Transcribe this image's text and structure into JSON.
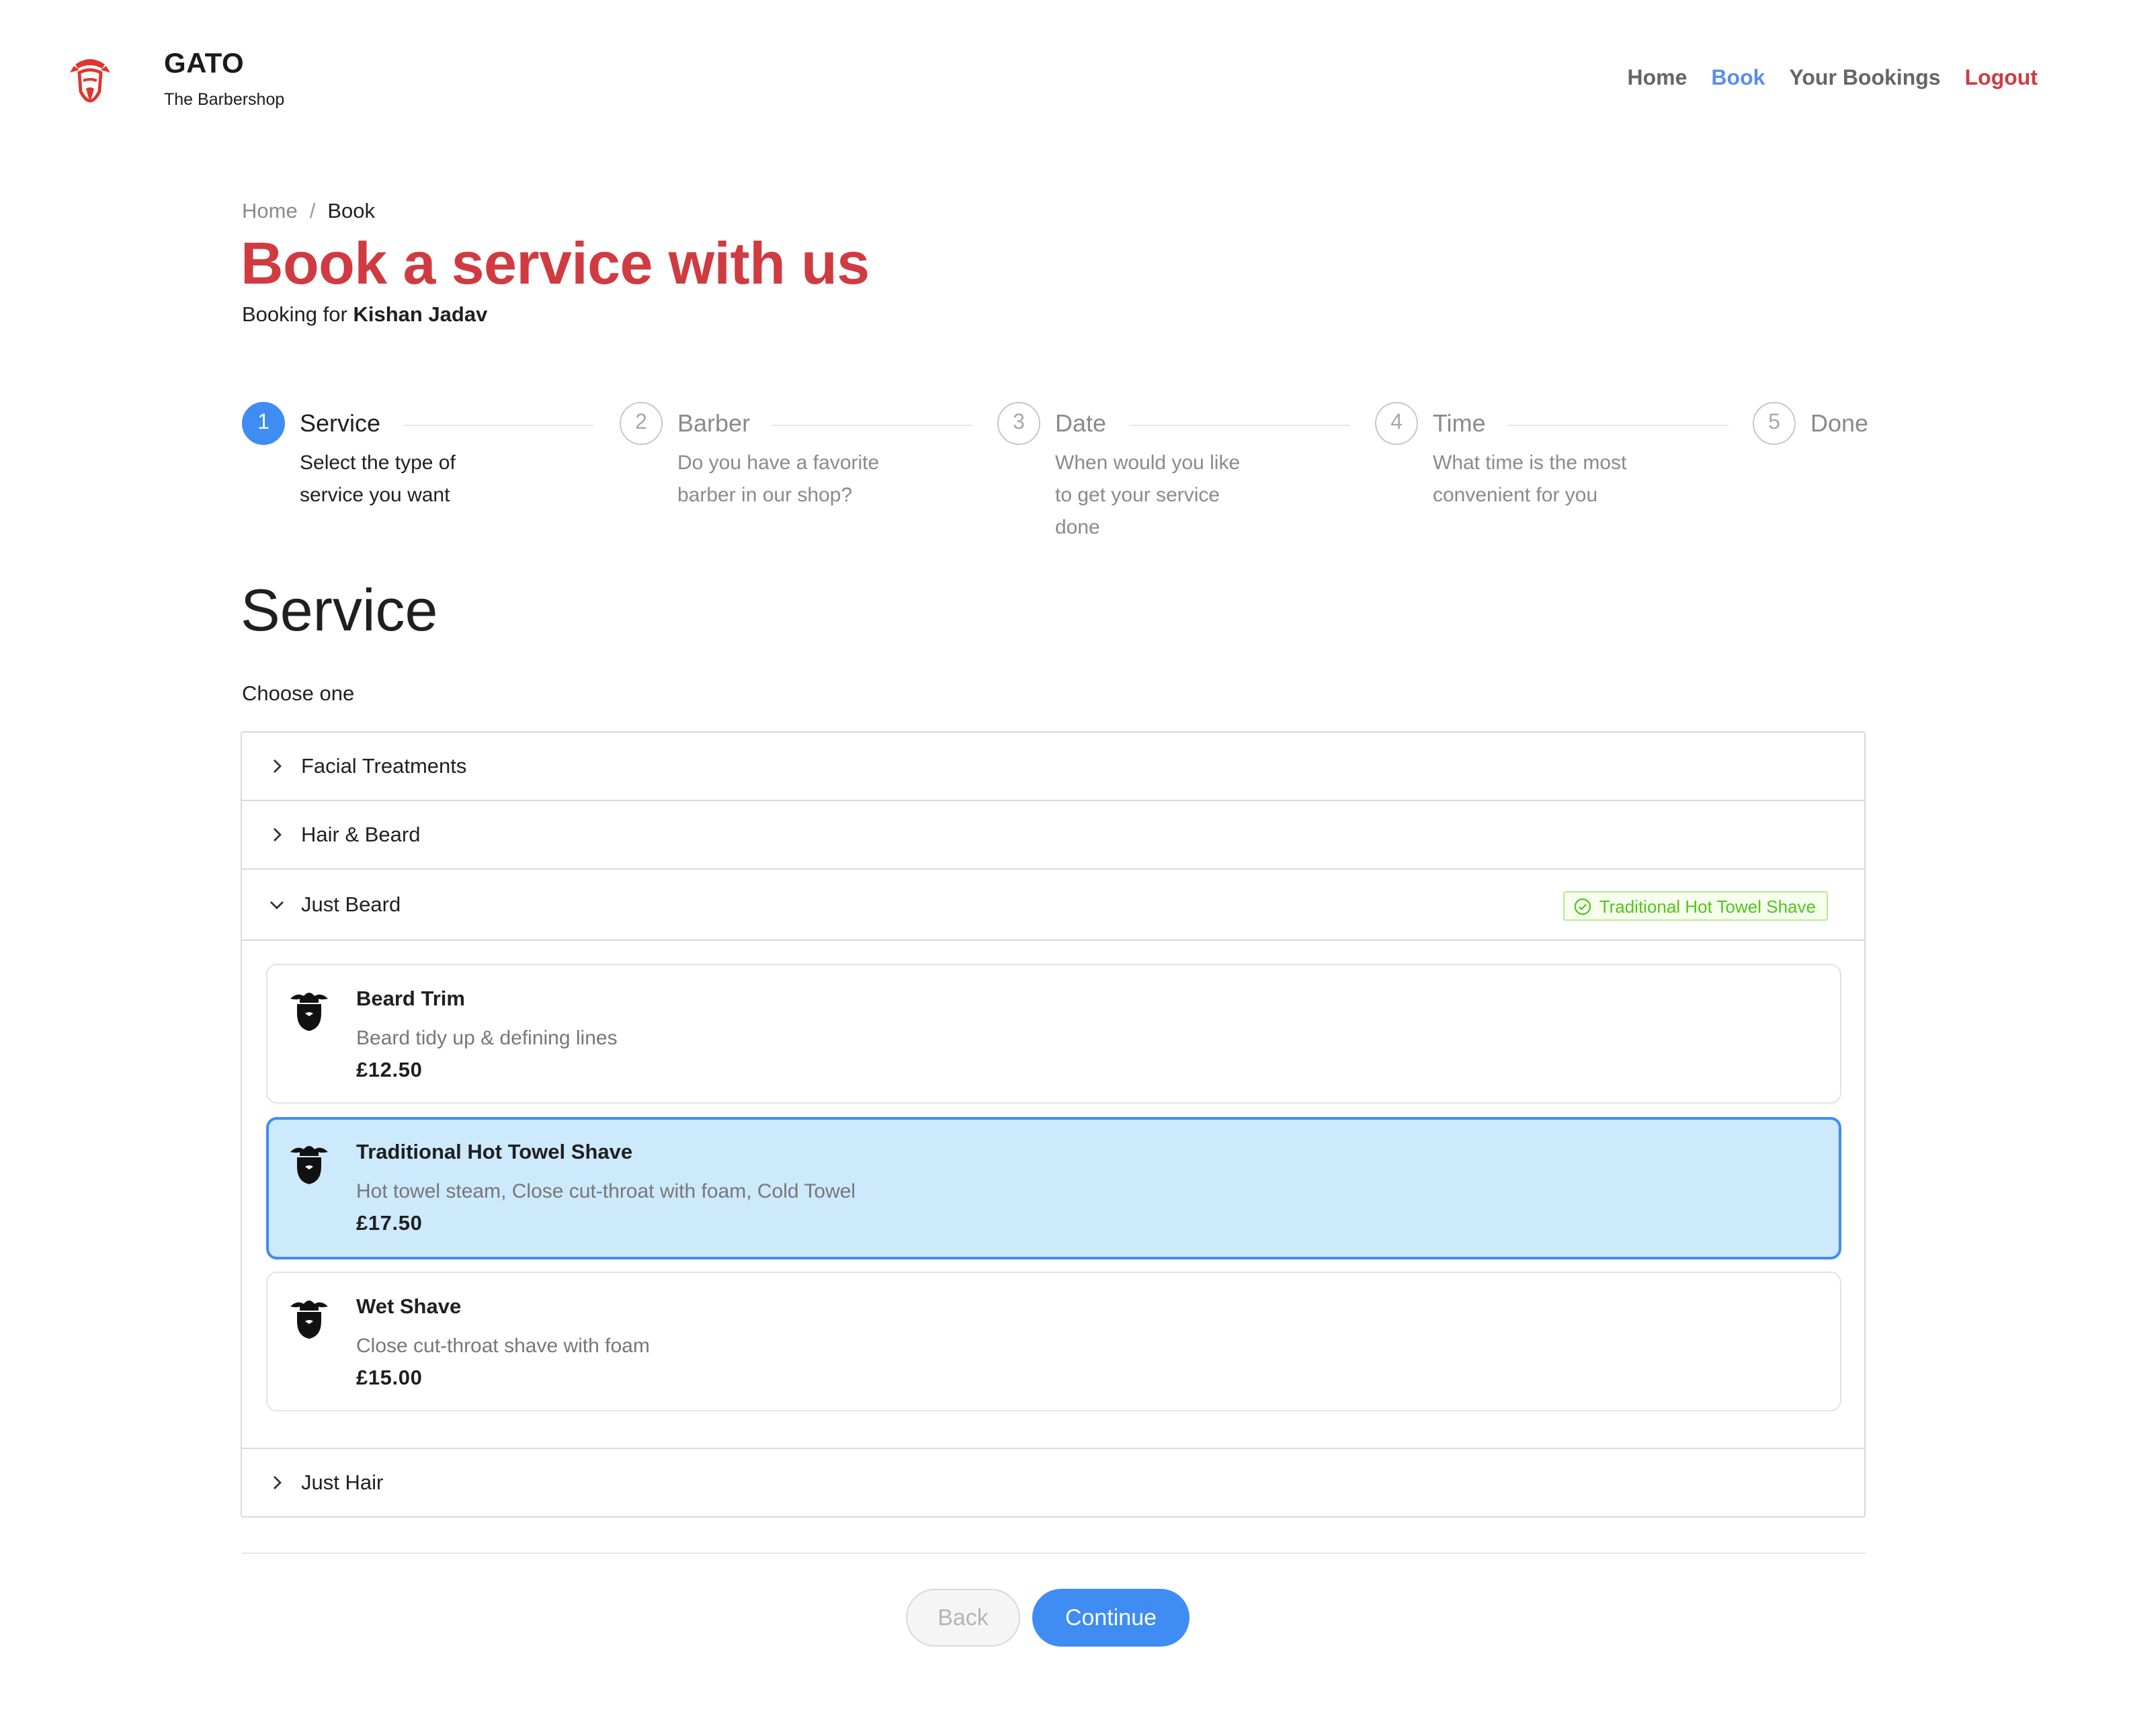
{
  "header": {
    "brand_name": "GATO",
    "brand_sub": "The Barbershop",
    "nav": [
      "Home",
      "Book",
      "Your Bookings",
      "Logout"
    ],
    "colors": {
      "active": "#5b8def",
      "logout": "#d03a3f"
    }
  },
  "breadcrumb": [
    "Home",
    "Book"
  ],
  "title": "Book a service with us",
  "booking_for_label": "Booking for",
  "customer": "Kishan Jadav",
  "steps": [
    {
      "num": "1",
      "title": "Service",
      "desc": "Select the type of service you want"
    },
    {
      "num": "2",
      "title": "Barber",
      "desc": "Do you have a favorite barber in our shop?"
    },
    {
      "num": "3",
      "title": "Date",
      "desc": "When would you like to get your service done"
    },
    {
      "num": "4",
      "title": "Time",
      "desc": "What time is the most convenient for you"
    },
    {
      "num": "5",
      "title": "Done",
      "desc": ""
    }
  ],
  "active_step": 1,
  "section_title": "Service",
  "choose_label": "Choose one",
  "categories": [
    {
      "label": "Facial Treatments",
      "expanded": false
    },
    {
      "label": "Hair & Beard",
      "expanded": false
    },
    {
      "label": "Just Beard",
      "expanded": true,
      "tag": "Traditional Hot Towel Shave"
    },
    {
      "label": "Just Hair",
      "expanded": false
    }
  ],
  "services": [
    {
      "name": "Beard Trim",
      "desc": "Beard tidy up & defining lines",
      "price": "£12.50",
      "selected": false,
      "icon": "beard-icon"
    },
    {
      "name": "Traditional Hot Towel Shave",
      "desc": "Hot towel steam, Close cut-throat with foam, Cold Towel",
      "price": "£17.50",
      "selected": true,
      "icon": "beard-icon"
    },
    {
      "name": "Wet Shave",
      "desc": "Close cut-throat shave with foam",
      "price": "£15.00",
      "selected": false,
      "icon": "beard-icon"
    }
  ],
  "buttons": {
    "back": "Back",
    "continue": "Continue"
  },
  "colors": {
    "brand_red": "#cf3b41",
    "primary_blue": "#3f8cf3",
    "selected_bg": "#cde9fc",
    "tag_green": "#52c41a"
  }
}
